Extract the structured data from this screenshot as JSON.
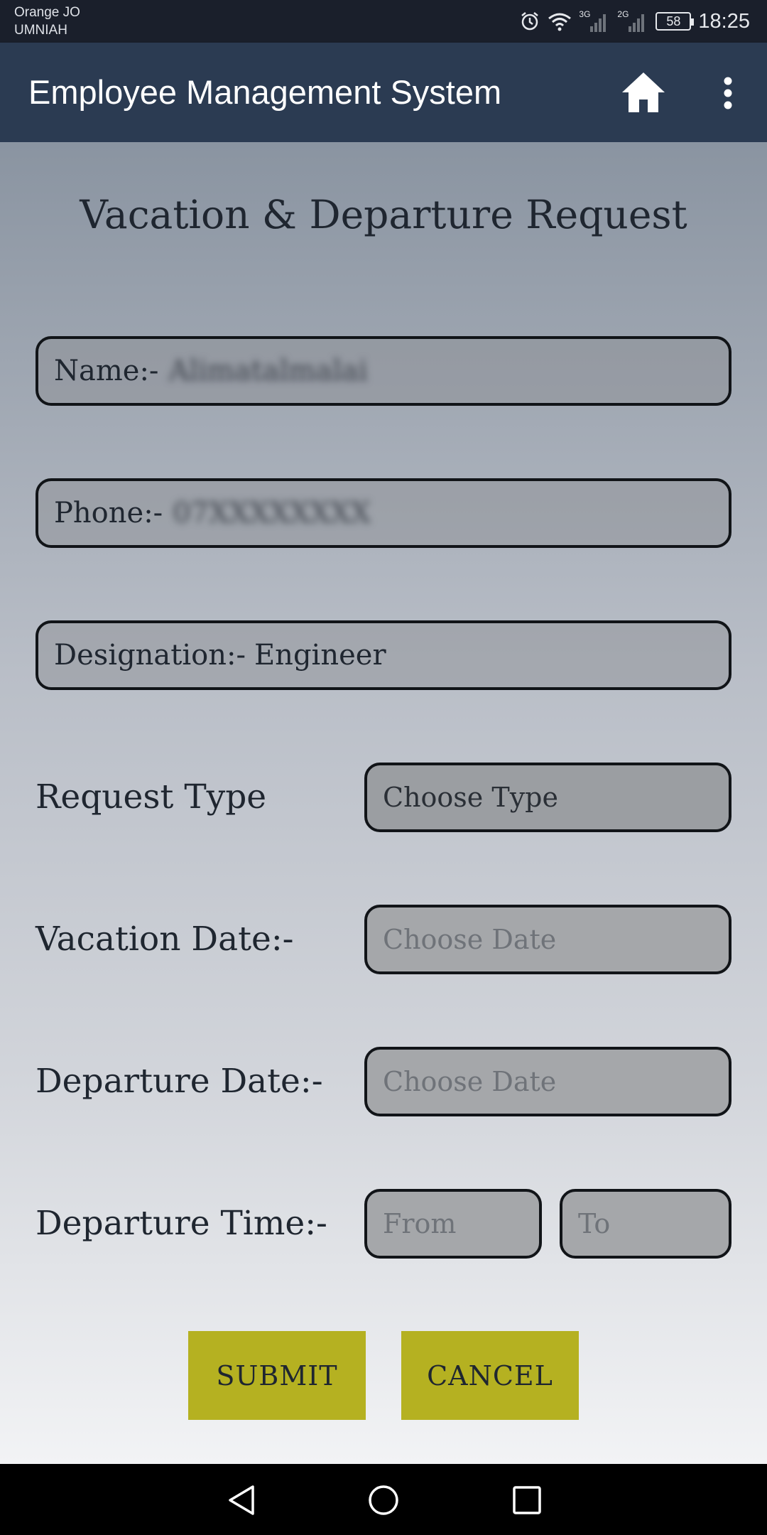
{
  "status_bar": {
    "carrier_line1": "Orange JO",
    "carrier_line2": "UMNIAH",
    "network1": "3G",
    "network2": "2G",
    "battery": "58",
    "time": "18:25"
  },
  "app_bar": {
    "title": "Employee Management System",
    "color": "#2b3b52"
  },
  "form": {
    "title": "Vacation & Departure Request",
    "name_label": "Name:-",
    "name_value": "Alimatalmalai",
    "phone_label": "Phone:-",
    "phone_value": "07XXXXXXXX",
    "designation_label": "Designation:-",
    "designation_value": "Engineer",
    "request_type_label": "Request Type",
    "request_type_value": "Choose Type",
    "vacation_date_label": "Vacation Date:-",
    "vacation_date_placeholder": "Choose Date",
    "departure_date_label": "Departure Date:-",
    "departure_date_placeholder": "Choose Date",
    "departure_time_label": "Departure Time:-",
    "time_from_placeholder": "From",
    "time_to_placeholder": "To"
  },
  "buttons": {
    "submit": "SUBMIT",
    "cancel": "CANCEL",
    "color": "#b5b121"
  },
  "nav_bar": {
    "icons": [
      "back-icon",
      "home-circle-icon",
      "recents-icon"
    ]
  }
}
